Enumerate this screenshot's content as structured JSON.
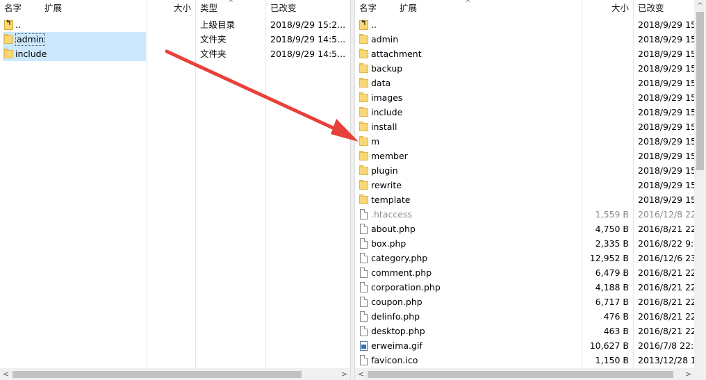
{
  "left": {
    "headers": {
      "name": "名字",
      "ext": "扩展",
      "size": "大小",
      "type": "类型",
      "modified": "已改变"
    },
    "rows": [
      {
        "icon": "up",
        "name": "..",
        "size": "",
        "type": "上级目录",
        "modified": "2018/9/29 15:2...",
        "selected": false,
        "focused": false
      },
      {
        "icon": "folder",
        "name": "admin",
        "size": "",
        "type": "文件夹",
        "modified": "2018/9/29 14:5...",
        "selected": true,
        "focused": true
      },
      {
        "icon": "folder",
        "name": "include",
        "size": "",
        "type": "文件夹",
        "modified": "2018/9/29 14:5...",
        "selected": true,
        "focused": false
      }
    ]
  },
  "right": {
    "headers": {
      "name": "名字",
      "ext": "扩展",
      "size": "大小",
      "modified": "已改变"
    },
    "rows": [
      {
        "icon": "up",
        "name": "..",
        "size": "",
        "modified": "2018/9/29 15:"
      },
      {
        "icon": "folder",
        "name": "admin",
        "size": "",
        "modified": "2018/9/29 15:"
      },
      {
        "icon": "folder",
        "name": "attachment",
        "size": "",
        "modified": "2018/9/29 15:"
      },
      {
        "icon": "folder",
        "name": "backup",
        "size": "",
        "modified": "2018/9/29 15:"
      },
      {
        "icon": "folder",
        "name": "data",
        "size": "",
        "modified": "2018/9/29 15:"
      },
      {
        "icon": "folder",
        "name": "images",
        "size": "",
        "modified": "2018/9/29 15:"
      },
      {
        "icon": "folder",
        "name": "include",
        "size": "",
        "modified": "2018/9/29 15:"
      },
      {
        "icon": "folder",
        "name": "install",
        "size": "",
        "modified": "2018/9/29 15:"
      },
      {
        "icon": "folder",
        "name": "m",
        "size": "",
        "modified": "2018/9/29 15:"
      },
      {
        "icon": "folder",
        "name": "member",
        "size": "",
        "modified": "2018/9/29 15:"
      },
      {
        "icon": "folder",
        "name": "plugin",
        "size": "",
        "modified": "2018/9/29 15:"
      },
      {
        "icon": "folder",
        "name": "rewrite",
        "size": "",
        "modified": "2018/9/29 15:"
      },
      {
        "icon": "folder",
        "name": "template",
        "size": "",
        "modified": "2018/9/29 15:"
      },
      {
        "icon": "file",
        "name": ".htaccess",
        "size": "1,559 B",
        "modified": "2016/12/8 22:",
        "muted": true
      },
      {
        "icon": "file",
        "name": "about.php",
        "size": "4,750 B",
        "modified": "2016/8/21 22:"
      },
      {
        "icon": "file",
        "name": "box.php",
        "size": "2,335 B",
        "modified": "2016/8/22 9:2"
      },
      {
        "icon": "file",
        "name": "category.php",
        "size": "12,952 B",
        "modified": "2016/12/6 23:"
      },
      {
        "icon": "file",
        "name": "comment.php",
        "size": "6,479 B",
        "modified": "2016/8/21 22:"
      },
      {
        "icon": "file",
        "name": "corporation.php",
        "size": "4,188 B",
        "modified": "2016/8/21 22:"
      },
      {
        "icon": "file",
        "name": "coupon.php",
        "size": "6,717 B",
        "modified": "2016/8/21 22:"
      },
      {
        "icon": "file",
        "name": "delinfo.php",
        "size": "476 B",
        "modified": "2016/8/21 22:"
      },
      {
        "icon": "file",
        "name": "desktop.php",
        "size": "463 B",
        "modified": "2016/8/21 22:"
      },
      {
        "icon": "image",
        "name": "erweima.gif",
        "size": "10,627 B",
        "modified": "2016/7/8 22:2"
      },
      {
        "icon": "file",
        "name": "favicon.ico",
        "size": "1,150 B",
        "modified": "2013/12/28 1("
      }
    ]
  },
  "colors": {
    "selection": "#cce8ff",
    "arrow": "#e8403a",
    "folder": "#f8d775"
  }
}
